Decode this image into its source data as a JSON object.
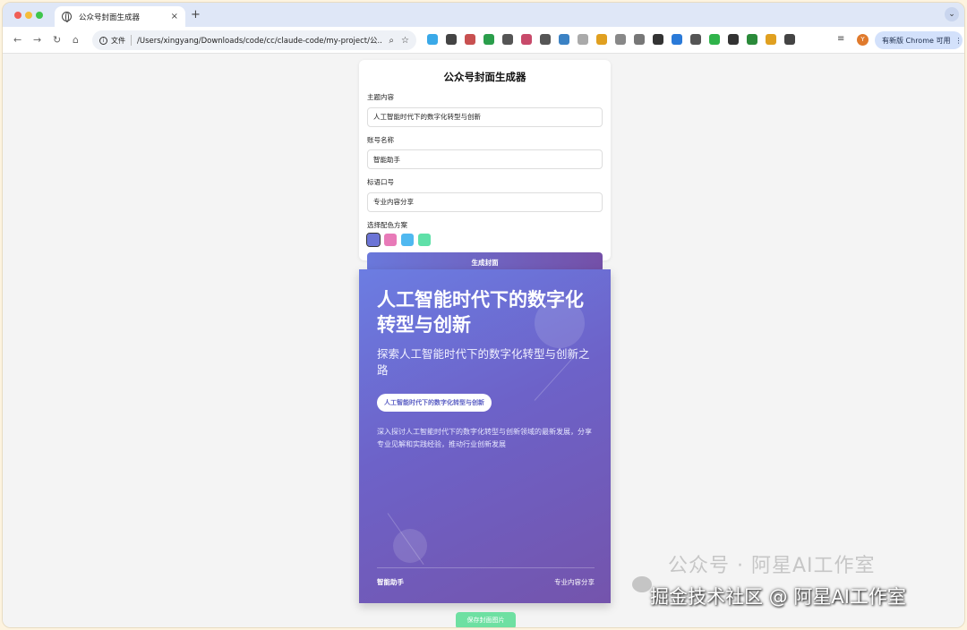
{
  "browser": {
    "tab_title": "公众号封面生成器",
    "tab_close": "×",
    "new_tab": "+",
    "omnibox": {
      "file_label": "文件",
      "url": "/Users/xingyang/Downloads/code/cc/claude-code/my-project/公..."
    },
    "update_label": "有新版 Chrome 可用",
    "avatar_letter": "Y",
    "extension_colors": [
      "#3aa9e8",
      "#444444",
      "#c85050",
      "#2a9e4b",
      "#555555",
      "#c84a6a",
      "#555555",
      "#3b82c4",
      "#aaaaaa",
      "#e0a020",
      "#888888",
      "#777777",
      "#333333",
      "#2a7ad8",
      "#555555",
      "#2fb34a",
      "#333333",
      "#2a8a3a",
      "#e0a020",
      "#444444"
    ]
  },
  "form": {
    "title": "公众号封面生成器",
    "topic_label": "主题内容",
    "topic_value": "人工智能时代下的数字化转型与创新",
    "account_label": "账号名称",
    "account_value": "智能助手",
    "slogan_label": "标语口号",
    "slogan_value": "专业内容分享",
    "color_label": "选择配色方案",
    "swatches": [
      {
        "name": "purple",
        "color": "#6b74d6",
        "selected": true
      },
      {
        "name": "pink",
        "color": "#e87ab8",
        "selected": false
      },
      {
        "name": "blue",
        "color": "#4fb8f0",
        "selected": false
      },
      {
        "name": "green",
        "color": "#5fe0a8",
        "selected": false
      }
    ],
    "generate_label": "生成封面"
  },
  "cover": {
    "title": "人工智能时代下的数字化转型与创新",
    "subtitle": "探索人工智能时代下的数字化转型与创新之路",
    "pill": "人工智能时代下的数字化转型与创新",
    "description": "深入探讨人工智能时代下的数字化转型与创新领域的最新发展，分享专业见解和实践经验，推动行业创新发展",
    "account": "智能助手",
    "slogan": "专业内容分享"
  },
  "save_label": "保存封面图片",
  "watermark": {
    "faint": "公众号 · 阿星AI工作室",
    "main": "掘金技术社区 @ 阿星AI工作室"
  }
}
